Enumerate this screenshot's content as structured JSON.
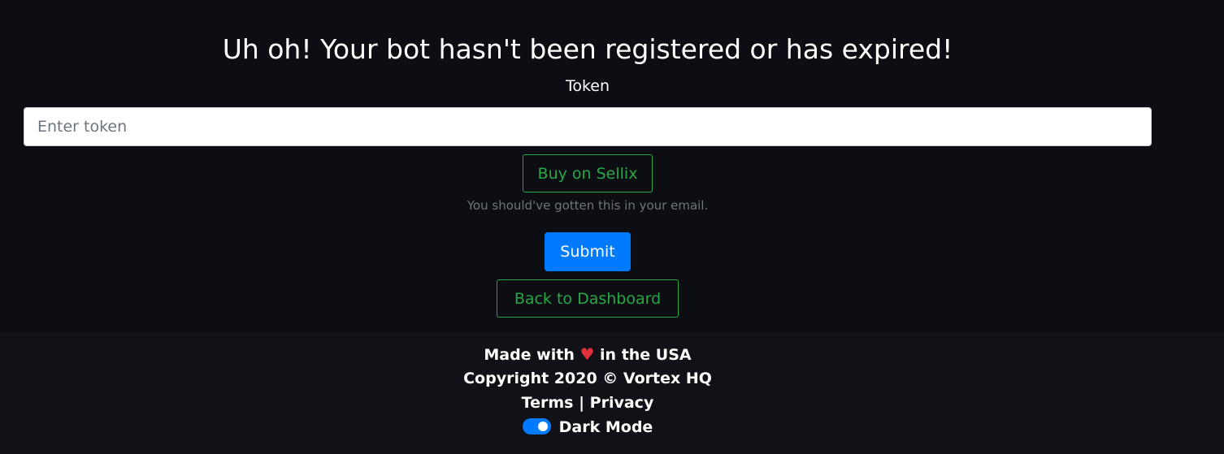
{
  "main": {
    "title": "Uh oh! Your bot hasn't been registered or has expired!",
    "token_label": "Token",
    "token_input": {
      "value": "",
      "placeholder": "Enter token"
    },
    "sellix_button": "Buy on Sellix",
    "hint": "You should've gotten this in your email.",
    "submit_button": "Submit",
    "dashboard_button": "Back to Dashboard"
  },
  "footer": {
    "made_prefix": "Made with",
    "heart_icon": "heart-icon",
    "heart_glyph": "♥",
    "made_suffix": "in the USA",
    "copyright": "Copyright 2020 © Vortex HQ",
    "terms_link": "Terms",
    "separator": "|",
    "privacy_link": "Privacy",
    "dark_mode_label": "Dark Mode",
    "dark_mode_on": true
  },
  "colors": {
    "background": "#0d0e13",
    "footer_background": "#111117",
    "accent_blue": "#007bff",
    "outline_green": "#28a745",
    "heart_red": "#e0313b",
    "muted_text": "#6c757d"
  }
}
